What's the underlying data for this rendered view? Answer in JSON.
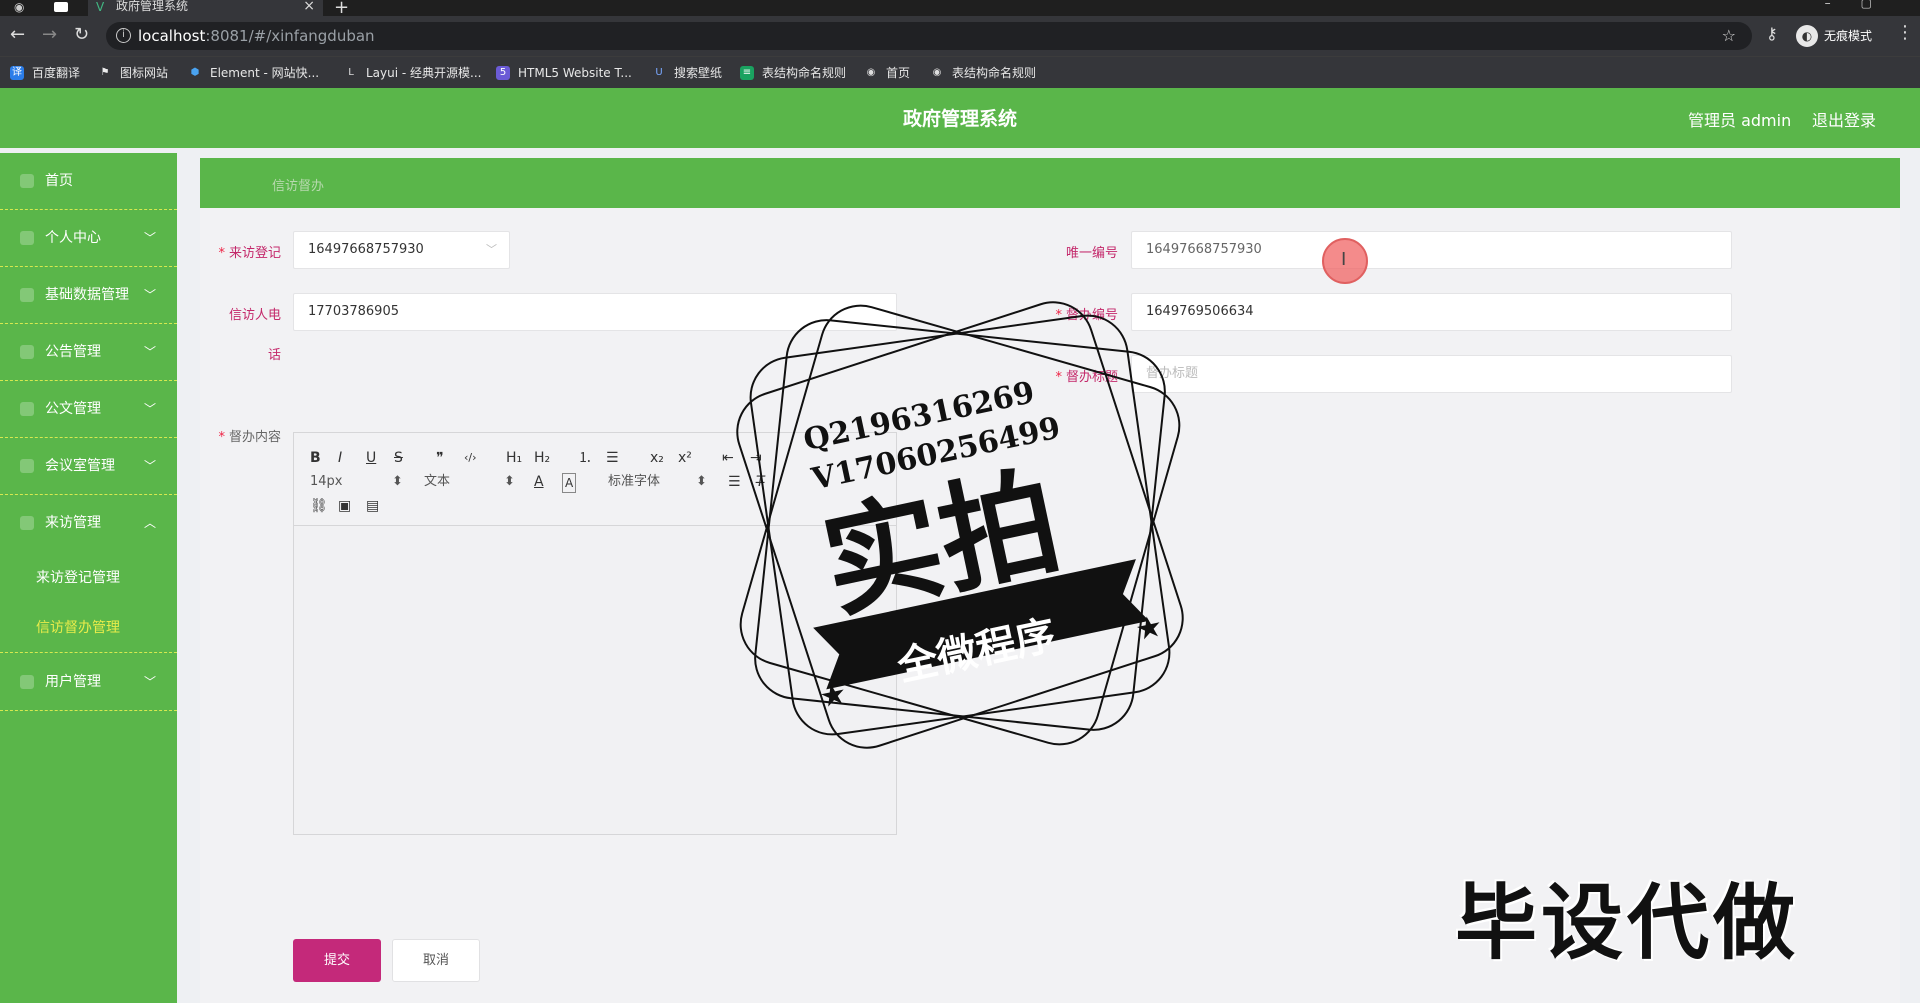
{
  "browser": {
    "tab_title": "政府管理系统",
    "url_host": "localhost",
    "url_path": ":8081/#/xinfangduban",
    "profile_label": "无痕模式",
    "bookmarks": [
      "百度翻译",
      "图标网站",
      "Element - 网站快...",
      "Layui - 经典开源模...",
      "HTML5 Website T...",
      "搜索壁纸",
      "表结构命名规则",
      "首页",
      "表结构命名规则"
    ]
  },
  "header": {
    "title": "政府管理系统",
    "admin": "管理员 admin",
    "logout": "退出登录"
  },
  "sidebar": {
    "items": [
      "首页",
      "个人中心",
      "基础数据管理",
      "公告管理",
      "公文管理",
      "会议室管理",
      "来访管理",
      "用户管理"
    ],
    "sub_items": [
      "来访登记管理",
      "信访督办管理"
    ]
  },
  "breadcrumb": "信访督办",
  "form": {
    "visit_label": "来访登记",
    "visit_value": "16497668757930",
    "unique_label": "唯一编号",
    "unique_value": "16497668757930",
    "phone_label_1": "信访人电",
    "phone_label_2": "话",
    "phone_value": "17703786905",
    "supervise_no_label": "督办编号",
    "supervise_no_value": "1649769506634",
    "supervise_title_label": "督办标题",
    "supervise_title_placeholder": "督办标题",
    "content_label": "督办内容",
    "editor": {
      "size": "14px",
      "block": "文本",
      "font": "标准字体"
    },
    "submit": "提交",
    "cancel": "取消"
  },
  "watermark": {
    "line1": "Q2196316269",
    "line2": "V17060256499",
    "big": "实拍",
    "ribbon": "全微程序",
    "bottom": "毕设代做"
  }
}
